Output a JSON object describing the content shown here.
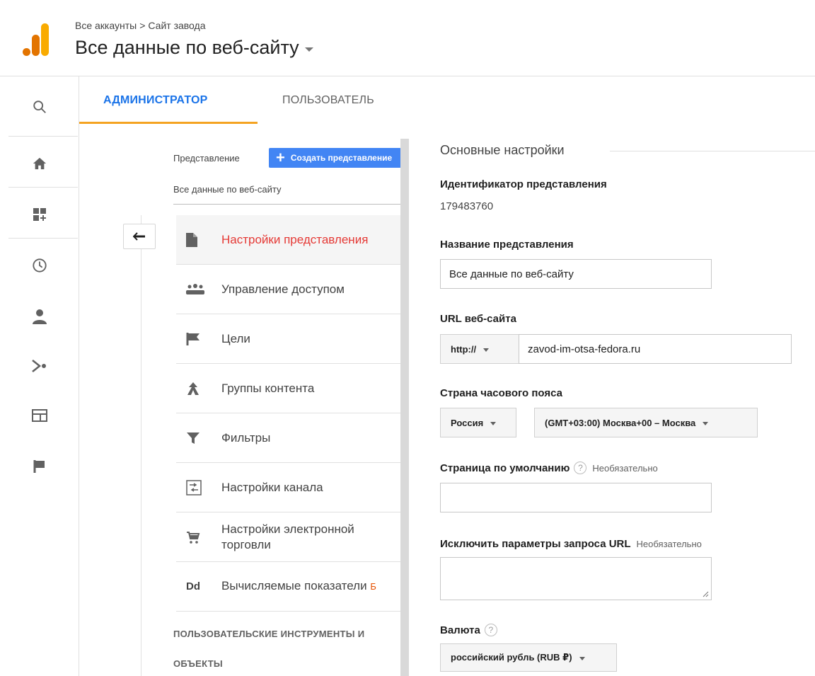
{
  "header": {
    "breadcrumb": [
      "Все аккаунты",
      ">",
      "Сайт завода"
    ],
    "title": "Все данные по веб-сайту"
  },
  "rail": {
    "items": [
      "search-icon",
      "home-icon",
      "dashboard-icon",
      "clock-icon",
      "person-icon",
      "acquisition-icon",
      "behavior-icon",
      "flag-icon"
    ]
  },
  "tabs": {
    "admin": "АДМИНИСТРАТОР",
    "user": "ПОЛЬЗОВАТЕЛЬ"
  },
  "view_panel": {
    "label": "Представление",
    "create_button": "Создать представление",
    "selected_view": "Все данные по веб-сайту",
    "menu": [
      {
        "label": "Настройки представления",
        "icon": "document-icon"
      },
      {
        "label": "Управление доступом",
        "icon": "people-icon"
      },
      {
        "label": "Цели",
        "icon": "flag-icon"
      },
      {
        "label": "Группы контента",
        "icon": "content-groups-icon"
      },
      {
        "label": "Фильтры",
        "icon": "filter-icon"
      },
      {
        "label": "Настройки канала",
        "icon": "channel-icon"
      },
      {
        "label": "Настройки электронной торговли",
        "icon": "cart-icon"
      },
      {
        "label": "Вычисляемые показатели",
        "badge": "Б",
        "icon": "dd-icon"
      }
    ],
    "section_title_1": "ПОЛЬЗОВАТЕЛЬСКИЕ ИНСТРУМЕНТЫ И",
    "section_title_2": "ОБЪЕКТЫ"
  },
  "form": {
    "section_title": "Основные настройки",
    "view_id_label": "Идентификатор представления",
    "view_id_value": "179483760",
    "view_name_label": "Название представления",
    "view_name_value": "Все данные по веб-сайту",
    "url_label": "URL веб-сайта",
    "protocol": "http://",
    "url_value": "zavod-im-otsa-fedora.ru",
    "timezone_label": "Страна часового пояса",
    "country": "Россия",
    "timezone": "(GMT+03:00) Москва+00 – Москва",
    "default_page_label": "Страница по умолчанию",
    "optional": "Необязательно",
    "exclude_label": "Исключить параметры запроса URL",
    "currency_label": "Валюта",
    "currency_value": "российский рубль (RUB ₽)",
    "help_glyph": "?"
  },
  "colors": {
    "accent_blue": "#1a73e8",
    "tab_underline": "#f4a321",
    "selected_red": "#e53935",
    "button_blue": "#4285f4",
    "logo_orange": "#f9ab00",
    "logo_dark_orange": "#e37400"
  }
}
